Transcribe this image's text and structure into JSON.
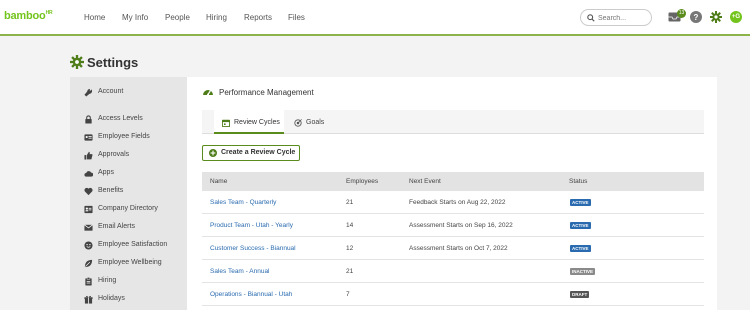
{
  "app": {
    "logo_text": "bamboo",
    "logo_sup": "HR"
  },
  "nav": {
    "items": [
      "Home",
      "My Info",
      "People",
      "Hiring",
      "Reports",
      "Files"
    ],
    "search_placeholder": "Search...",
    "inbox_count": "13",
    "avatar_initials": "+G"
  },
  "page": {
    "title": "Settings"
  },
  "sidebar": {
    "items": [
      {
        "label": "Account",
        "icon": "wrench-icon"
      },
      {
        "label": "Access Levels",
        "icon": "lock-icon"
      },
      {
        "label": "Employee Fields",
        "icon": "id-card-icon"
      },
      {
        "label": "Approvals",
        "icon": "thumbs-up-icon"
      },
      {
        "label": "Apps",
        "icon": "cloud-icon"
      },
      {
        "label": "Benefits",
        "icon": "heart-icon"
      },
      {
        "label": "Company Directory",
        "icon": "address-book-icon"
      },
      {
        "label": "Email Alerts",
        "icon": "envelope-icon"
      },
      {
        "label": "Employee Satisfaction",
        "icon": "smile-icon"
      },
      {
        "label": "Employee Wellbeing",
        "icon": "leaf-icon"
      },
      {
        "label": "Hiring",
        "icon": "clipboard-icon"
      },
      {
        "label": "Holidays",
        "icon": "gift-icon"
      }
    ]
  },
  "main": {
    "section_title": "Performance Management",
    "tabs": [
      {
        "label": "Review Cycles",
        "active": true
      },
      {
        "label": "Goals",
        "active": false
      }
    ],
    "create_button": "Create a Review Cycle",
    "table": {
      "columns": [
        "Name",
        "Employees",
        "Next Event",
        "Status"
      ],
      "rows": [
        {
          "name": "Sales Team - Quarterly",
          "employees": "21",
          "next_event": "Feedback Starts on Aug 22, 2022",
          "status": "ACTIVE"
        },
        {
          "name": "Product Team - Utah - Yearly",
          "employees": "14",
          "next_event": "Assessment Starts on Sep 16, 2022",
          "status": "ACTIVE"
        },
        {
          "name": "Customer Success - Biannual",
          "employees": "12",
          "next_event": "Assessment Starts on Oct 7, 2022",
          "status": "ACTIVE"
        },
        {
          "name": "Sales Team - Annual",
          "employees": "21",
          "next_event": "",
          "status": "INACTIVE"
        },
        {
          "name": "Operations - Biannual - Utah",
          "employees": "7",
          "next_event": "",
          "status": "DRAFT"
        }
      ]
    }
  },
  "colors": {
    "brand_green": "#73c41d",
    "dark_green": "#5a8c1d",
    "active": "#2a6bb0",
    "inactive": "#8a8a8a",
    "draft": "#555555",
    "link": "#2a6bb0"
  }
}
